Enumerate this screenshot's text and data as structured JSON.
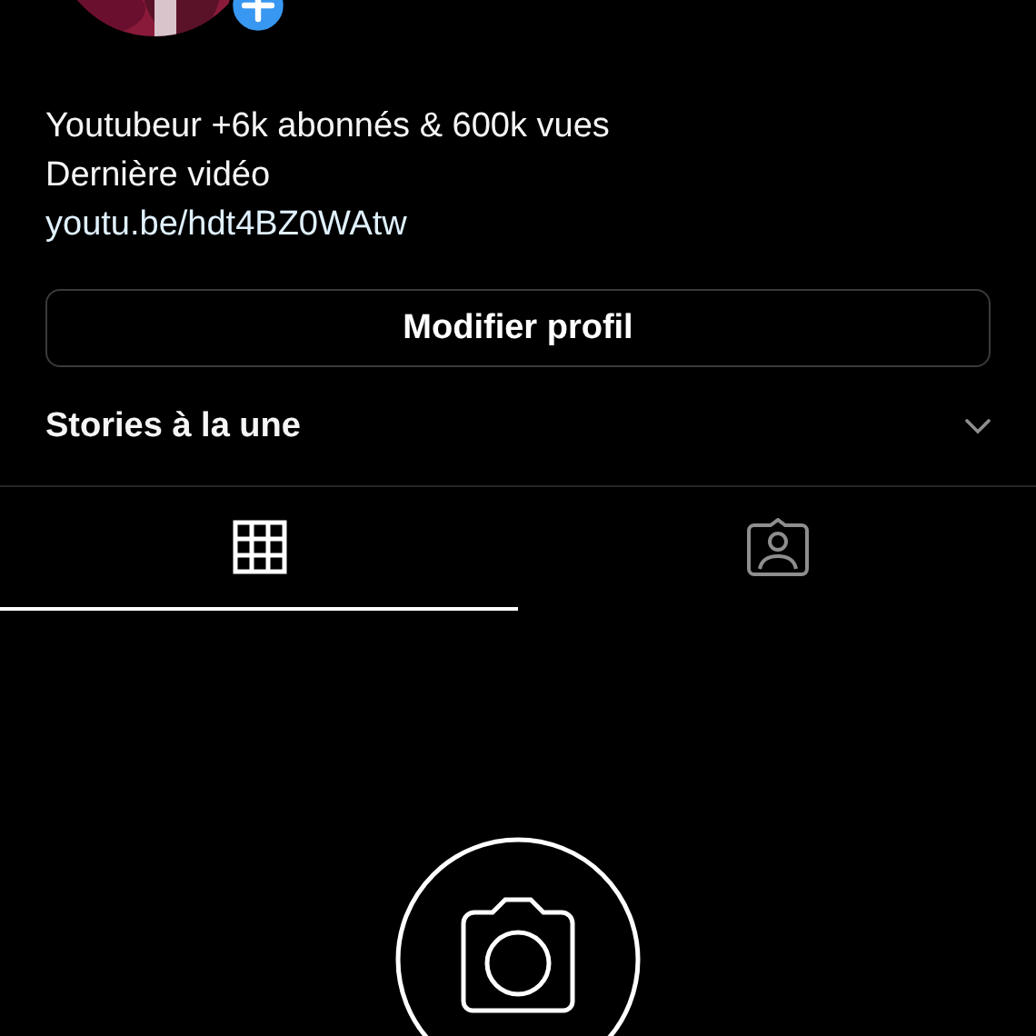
{
  "bio": {
    "lines": [
      "Youtubeur +6k abonnés & 600k vues",
      "Dernière vidéo"
    ],
    "link": "youtu.be/hdt4BZ0WAtw"
  },
  "edit_button": "Modifier profil",
  "highlights": {
    "title": "Stories à la une",
    "expanded": false
  },
  "tabs": [
    {
      "kind": "grid",
      "selected": true
    },
    {
      "kind": "tagged",
      "selected": false
    }
  ]
}
